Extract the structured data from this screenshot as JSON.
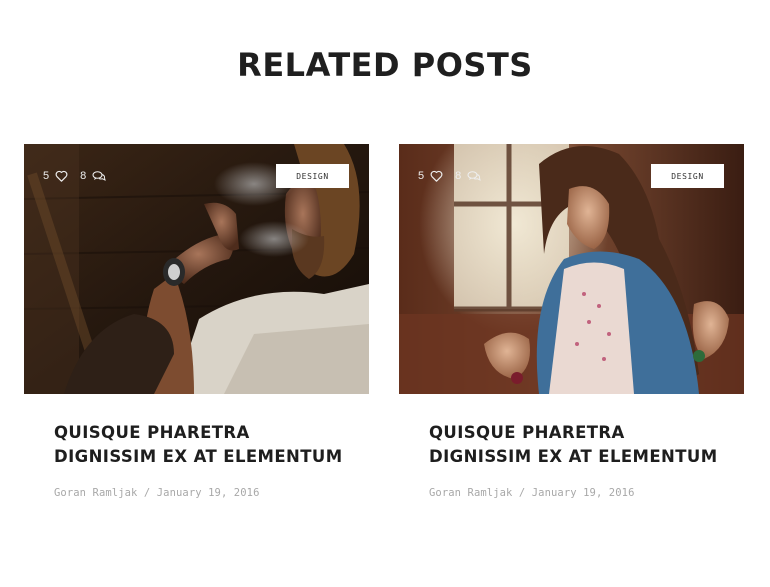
{
  "section": {
    "title": "RELATED POSTS"
  },
  "posts": [
    {
      "likes": "5",
      "comments": "8",
      "category": "DESIGN",
      "title": "QUISQUE PHARETRA DIGNISSIM EX AT ELEMENTUM",
      "author": "Goran Ramljak",
      "separator": "/",
      "date": "January 19, 2016"
    },
    {
      "likes": "5",
      "comments": "8",
      "category": "DESIGN",
      "title": "QUISQUE PHARETRA DIGNISSIM EX AT ELEMENTUM",
      "author": "Goran Ramljak",
      "separator": "/",
      "date": "January 19, 2016"
    }
  ],
  "icons": {
    "like": "heart-icon",
    "comment": "chat-bubbles-icon"
  }
}
